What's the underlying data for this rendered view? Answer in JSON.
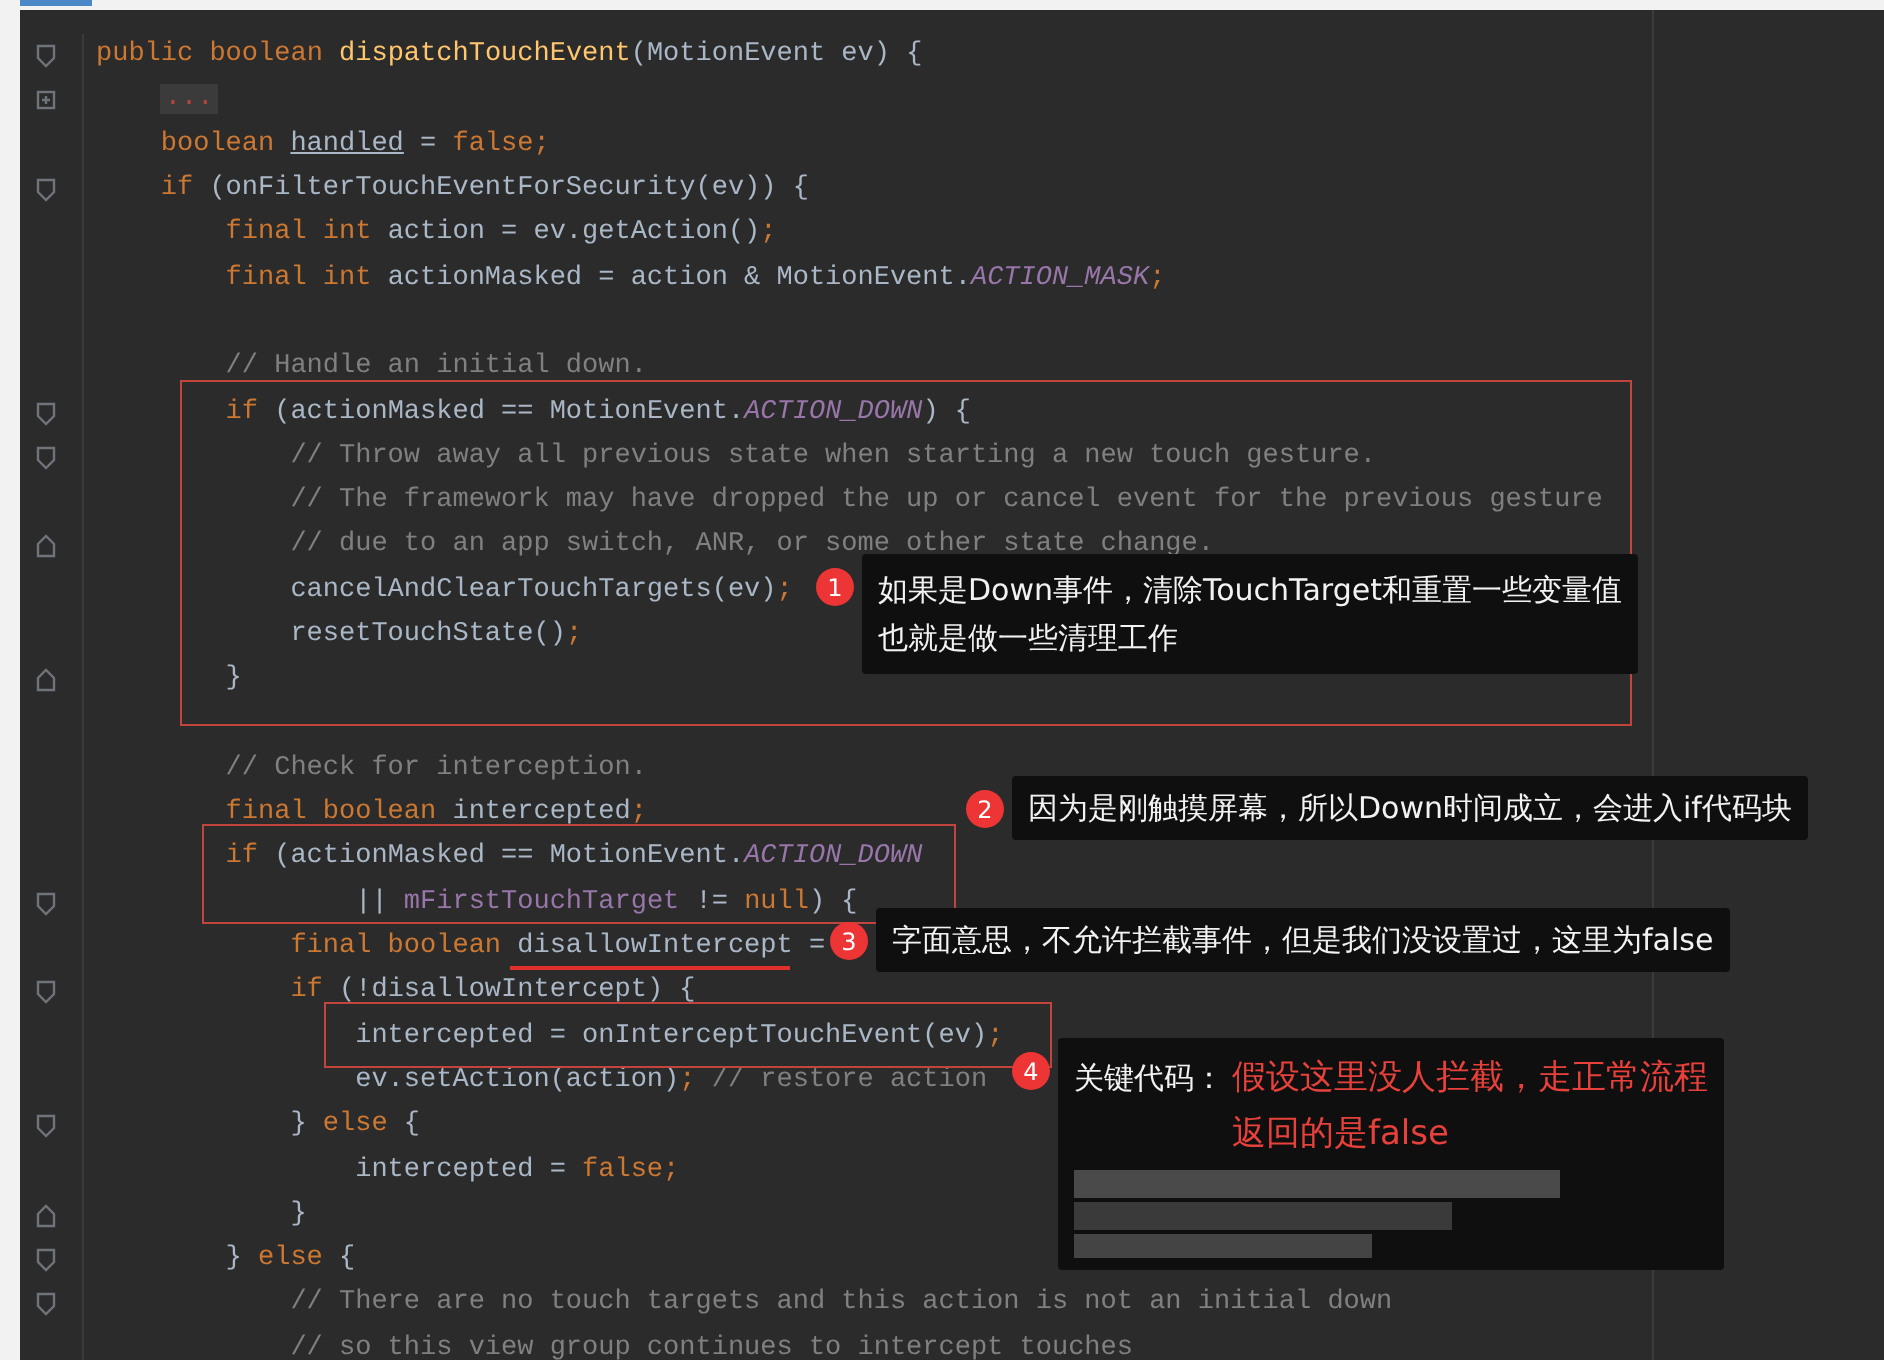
{
  "code_lines": [
    {
      "gutter": {
        "kind": "open"
      },
      "tokens": [
        {
          "t": "public boolean ",
          "kind": "kw"
        },
        {
          "t": "dispatchTouchEvent",
          "kind": "fn"
        },
        {
          "t": "(MotionEvent ev) {",
          "kind": "txt"
        }
      ]
    },
    {
      "gutter": {
        "kind": "plus"
      },
      "tokens": [
        {
          "t": "    ...",
          "kind": "fold"
        }
      ]
    },
    {
      "tokens": [
        {
          "t": "    boolean ",
          "kind": "kw"
        },
        {
          "t": "handled",
          "kind": "ul"
        },
        {
          "t": " = ",
          "kind": "txt"
        },
        {
          "t": "false;",
          "kind": "kw"
        }
      ]
    },
    {
      "gutter": {
        "kind": "open"
      },
      "tokens": [
        {
          "t": "    if ",
          "kind": "kw"
        },
        {
          "t": "(onFilterTouchEventForSecurity(ev)) {",
          "kind": "txt"
        }
      ]
    },
    {
      "tokens": [
        {
          "t": "        final int ",
          "kind": "kw"
        },
        {
          "t": "action = ev.getAction()",
          "kind": "txt"
        },
        {
          "t": ";",
          "kind": "kw"
        }
      ]
    },
    {
      "tokens": [
        {
          "t": "        final int ",
          "kind": "kw"
        },
        {
          "t": "actionMasked = action & MotionEvent.",
          "kind": "txt"
        },
        {
          "t": "ACTION_MASK",
          "kind": "const"
        },
        {
          "t": ";",
          "kind": "kw"
        }
      ]
    },
    {
      "blank": true
    },
    {
      "tokens": [
        {
          "t": "        // Handle an initial down.",
          "kind": "cm"
        }
      ]
    },
    {
      "gutter": {
        "kind": "open"
      },
      "tokens": [
        {
          "t": "        if ",
          "kind": "kw"
        },
        {
          "t": "(actionMasked == MotionEvent.",
          "kind": "txt"
        },
        {
          "t": "ACTION_DOWN",
          "kind": "const"
        },
        {
          "t": ") {",
          "kind": "txt"
        }
      ]
    },
    {
      "gutter": {
        "kind": "open"
      },
      "tokens": [
        {
          "t": "            // Throw away all previous state when starting a new touch gesture.",
          "kind": "cm"
        }
      ]
    },
    {
      "tokens": [
        {
          "t": "            // The framework may have dropped the up or cancel event for the previous gesture",
          "kind": "cm"
        }
      ]
    },
    {
      "gutter": {
        "kind": "close"
      },
      "tokens": [
        {
          "t": "            // due to an app switch, ANR, or some other state change.",
          "kind": "cm"
        }
      ]
    },
    {
      "tokens": [
        {
          "t": "            cancelAndClearTouchTargets(ev)",
          "kind": "txt"
        },
        {
          "t": ";",
          "kind": "kw"
        }
      ]
    },
    {
      "tokens": [
        {
          "t": "            resetTouchState()",
          "kind": "txt"
        },
        {
          "t": ";",
          "kind": "kw"
        }
      ]
    },
    {
      "gutter": {
        "kind": "close"
      },
      "tokens": [
        {
          "t": "        }",
          "kind": "txt"
        }
      ]
    },
    {
      "blank": true
    },
    {
      "tokens": [
        {
          "t": "        // Check for interception.",
          "kind": "cm"
        }
      ]
    },
    {
      "tokens": [
        {
          "t": "        final boolean ",
          "kind": "kw"
        },
        {
          "t": "intercepted",
          "kind": "txt"
        },
        {
          "t": ";",
          "kind": "kw"
        }
      ]
    },
    {
      "tokens": [
        {
          "t": "        if ",
          "kind": "kw"
        },
        {
          "t": "(actionMasked == MotionEvent.",
          "kind": "txt"
        },
        {
          "t": "ACTION_DOWN",
          "kind": "const"
        }
      ]
    },
    {
      "gutter": {
        "kind": "open"
      },
      "tokens": [
        {
          "t": "                || ",
          "kind": "txt"
        },
        {
          "t": "mFirstTouchTarget",
          "kind": "fld"
        },
        {
          "t": " != ",
          "kind": "txt"
        },
        {
          "t": "null",
          "kind": "kw"
        },
        {
          "t": ") {",
          "kind": "txt"
        }
      ]
    },
    {
      "tokens": [
        {
          "t": "            final boolean ",
          "kind": "kw"
        },
        {
          "t": "disallowIntercept",
          "kind": "txt"
        },
        {
          "t": " =",
          "kind": "txt"
        }
      ]
    },
    {
      "gutter": {
        "kind": "open"
      },
      "tokens": [
        {
          "t": "            if ",
          "kind": "kw"
        },
        {
          "t": "(!disallowIntercept) {",
          "kind": "txt"
        }
      ]
    },
    {
      "tokens": [
        {
          "t": "                intercepted = onInterceptTouchEvent(ev)",
          "kind": "txt"
        },
        {
          "t": ";",
          "kind": "kw"
        }
      ]
    },
    {
      "tokens": [
        {
          "t": "                ev.setAction(action)",
          "kind": "txt"
        },
        {
          "t": "; ",
          "kind": "kw"
        },
        {
          "t": "// restore action",
          "kind": "cm"
        }
      ]
    },
    {
      "gutter": {
        "kind": "open"
      },
      "tokens": [
        {
          "t": "            } ",
          "kind": "txt"
        },
        {
          "t": "else ",
          "kind": "kw"
        },
        {
          "t": "{",
          "kind": "txt"
        }
      ]
    },
    {
      "tokens": [
        {
          "t": "                intercepted = ",
          "kind": "txt"
        },
        {
          "t": "false;",
          "kind": "kw"
        }
      ]
    },
    {
      "gutter": {
        "kind": "close"
      },
      "tokens": [
        {
          "t": "            }",
          "kind": "txt"
        }
      ]
    },
    {
      "gutter": {
        "kind": "open"
      },
      "tokens": [
        {
          "t": "        } ",
          "kind": "txt"
        },
        {
          "t": "else ",
          "kind": "kw"
        },
        {
          "t": "{",
          "kind": "txt"
        }
      ]
    },
    {
      "gutter": {
        "kind": "open"
      },
      "tokens": [
        {
          "t": "            // There are no touch targets and this action is not an initial down",
          "kind": "cm"
        }
      ]
    },
    {
      "tokens": [
        {
          "t": "            // so this view group continues to intercept touches",
          "kind": "cm"
        }
      ]
    }
  ],
  "callouts": [
    {
      "number": "1",
      "kind": "note",
      "redacted": false,
      "lines": [
        "如果是Down事件，清除TouchTarget和重置一些变量值",
        "也就是做一些清理工作"
      ]
    },
    {
      "number": "2",
      "kind": "note",
      "redacted": false,
      "lines": [
        "因为是刚触摸屏幕，所以Down时间成立，会进入if代码块"
      ]
    },
    {
      "number": "3",
      "kind": "note",
      "redacted": false,
      "lines": [
        "字面意思，不允许拦截事件，但是我们没设置过，这里为false"
      ]
    },
    {
      "number": "4",
      "kind": "key",
      "label": "关键代码：",
      "redacted": true,
      "lines": [
        "假设这里没人拦截，走正常流程",
        "返回的是false"
      ]
    }
  ]
}
